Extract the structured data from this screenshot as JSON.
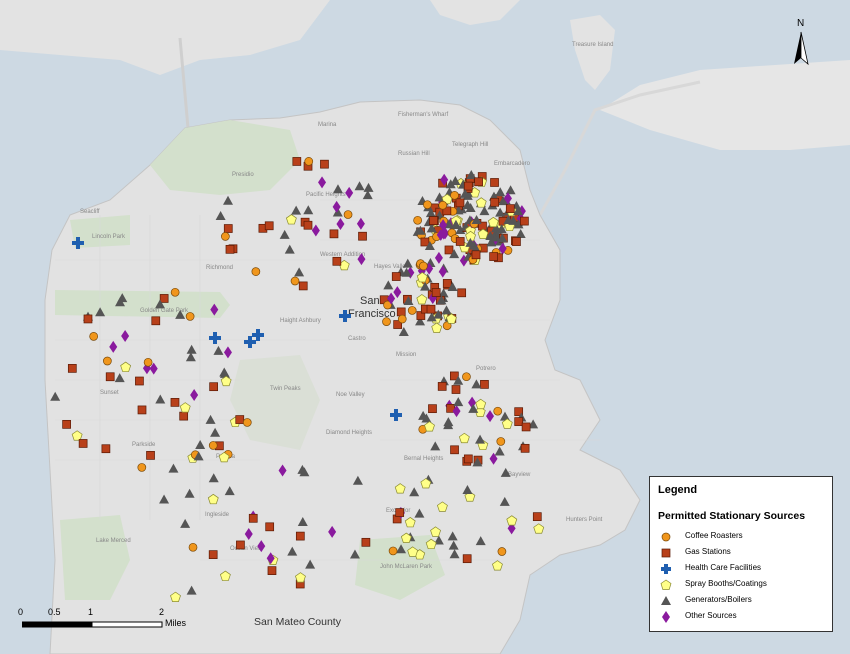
{
  "legend": {
    "title": "Legend",
    "subtitle": "Permitted Stationary Sources",
    "items": [
      {
        "label": "Coffee Roasters",
        "symbol": "circle",
        "color": "#f0961c"
      },
      {
        "label": "Gas Stations",
        "symbol": "square",
        "color": "#b8401a"
      },
      {
        "label": "Health Care Facilities",
        "symbol": "cross",
        "color": "#1f5fb0"
      },
      {
        "label": "Spray Booths/Coatings",
        "symbol": "pentagon",
        "color": "#ffff88"
      },
      {
        "label": "Generators/Boilers",
        "symbol": "triangle",
        "color": "#555555"
      },
      {
        "label": "Other Sources",
        "symbol": "diamond",
        "color": "#8a1a9e"
      }
    ]
  },
  "scale_bar": {
    "ticks": [
      "0",
      "0.5",
      "1",
      "2"
    ],
    "unit": "Miles"
  },
  "north_arrow": {
    "label": "N"
  },
  "map_labels": {
    "county": "San Mateo County",
    "city": [
      "San",
      "Francisco"
    ],
    "neighborhoods": [
      "Marina",
      "Presidio",
      "Pacific Heights",
      "Russian Hill",
      "Western Addition",
      "Richmond",
      "Golden Gate Park",
      "Haight Ashbury",
      "Sunset",
      "Parkside",
      "Noe Valley",
      "Diamond Heights",
      "Bernal Heights",
      "Excelsior",
      "Ingleside",
      "Ocean View",
      "Lake Merced",
      "Portola",
      "Potrero",
      "Mission",
      "Castro",
      "Lincoln Park",
      "Seacliff",
      "Treasure Island",
      "Hunters Point",
      "Bayview",
      "Twin Peaks",
      "John McLaren Park",
      "Embarcadero",
      "Fisherman's Wharf",
      "Telegraph Hill",
      "Hayes Valley"
    ]
  },
  "colors": {
    "water": "#cdd9e3",
    "land": "#e4e4e4",
    "park": "#d5e2cf"
  }
}
